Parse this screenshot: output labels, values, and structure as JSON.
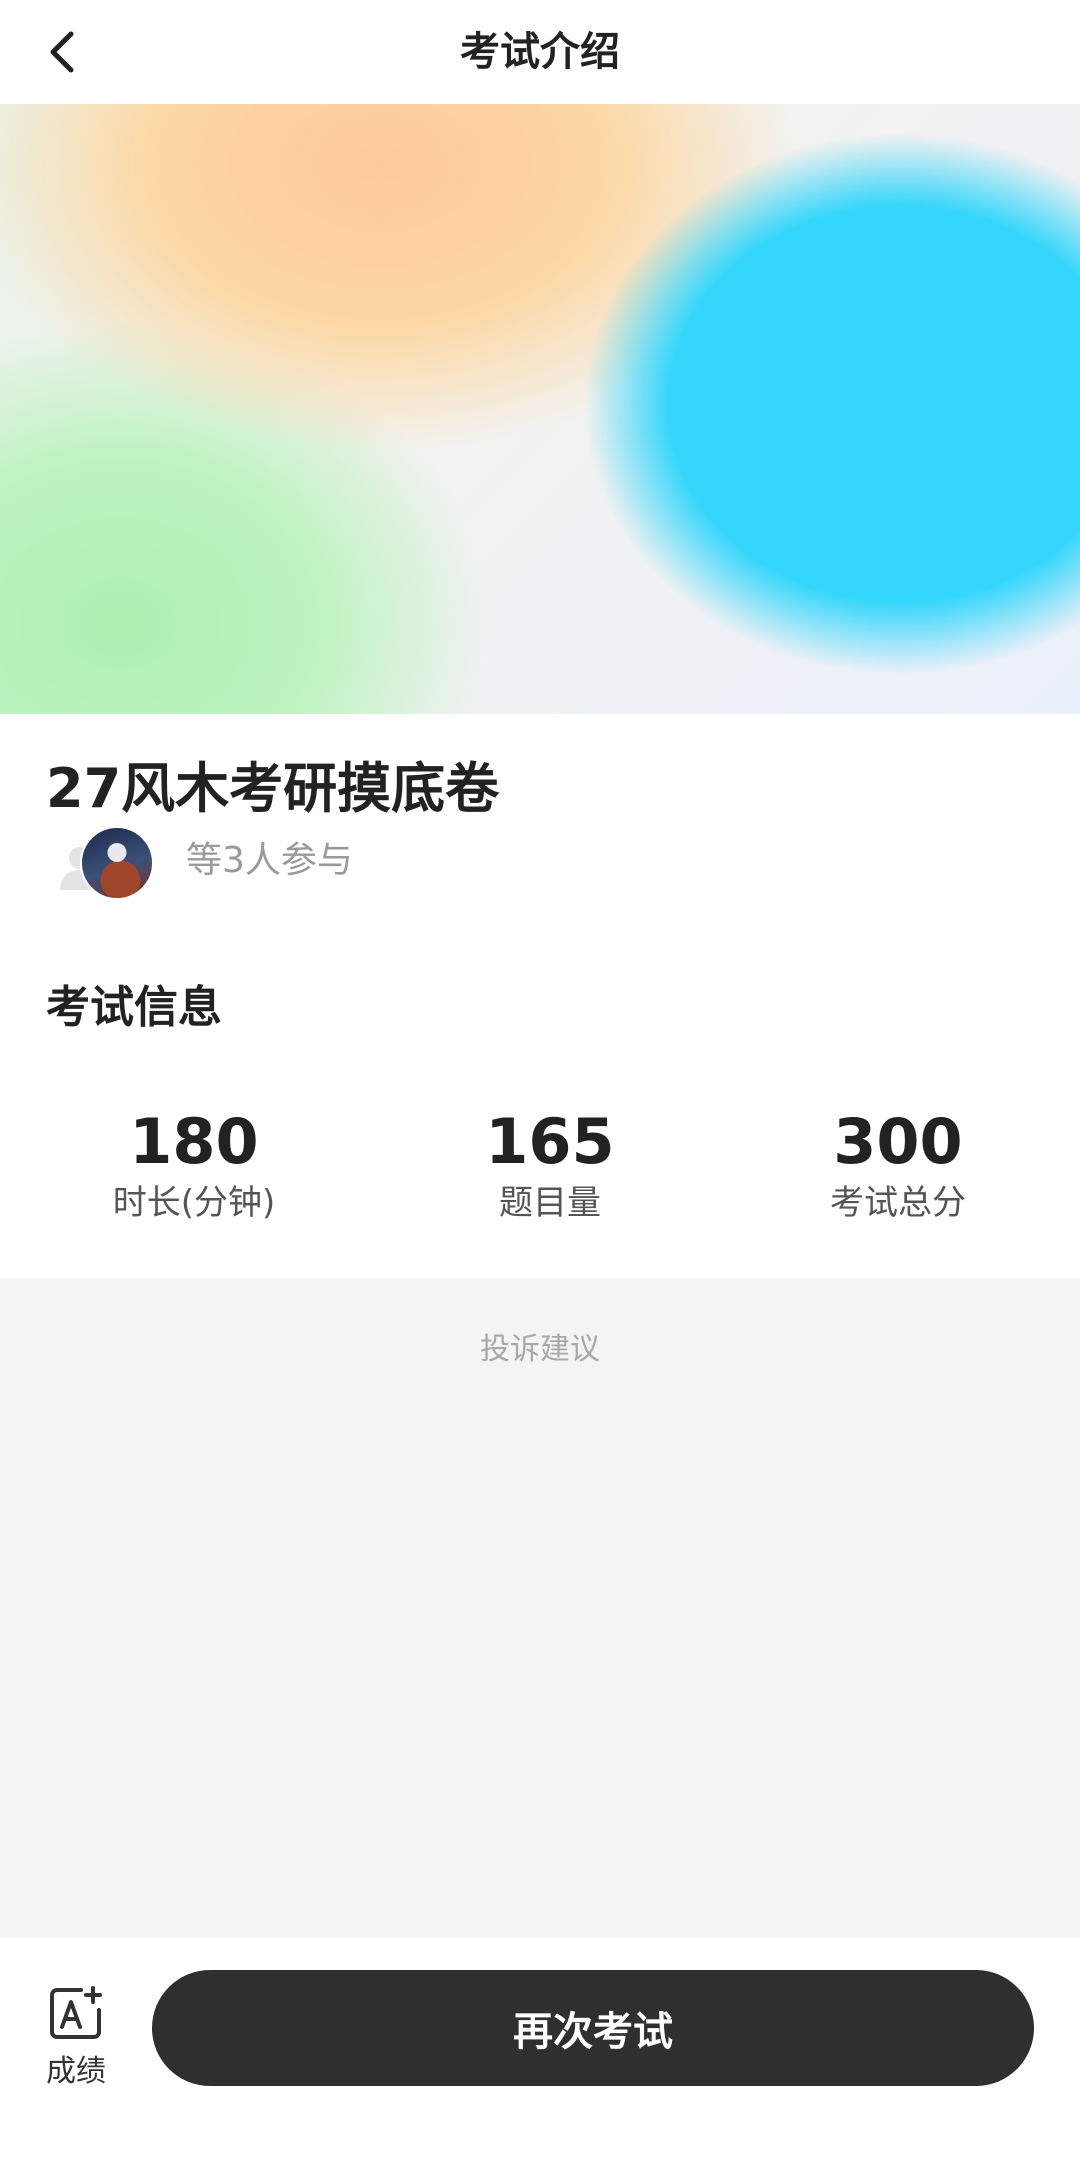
{
  "header": {
    "title": "考试介绍",
    "back_icon": "chevron-left-icon"
  },
  "banner": {
    "colors": [
      "#fdc99a",
      "#35d6fb",
      "#aef0b0"
    ]
  },
  "exam": {
    "title": "27风木考研摸底卷",
    "participants_text": "等3人参与"
  },
  "info": {
    "section_title": "考试信息",
    "stats": [
      {
        "value": "180",
        "label": "时长(分钟)"
      },
      {
        "value": "165",
        "label": "题目量"
      },
      {
        "value": "300",
        "label": "考试总分"
      }
    ]
  },
  "complaint_link": "投诉建议",
  "bottom": {
    "score_label": "成绩",
    "score_icon": "score-card-icon",
    "retry_label": "再次考试",
    "retry_color": "#2f2f2f"
  }
}
